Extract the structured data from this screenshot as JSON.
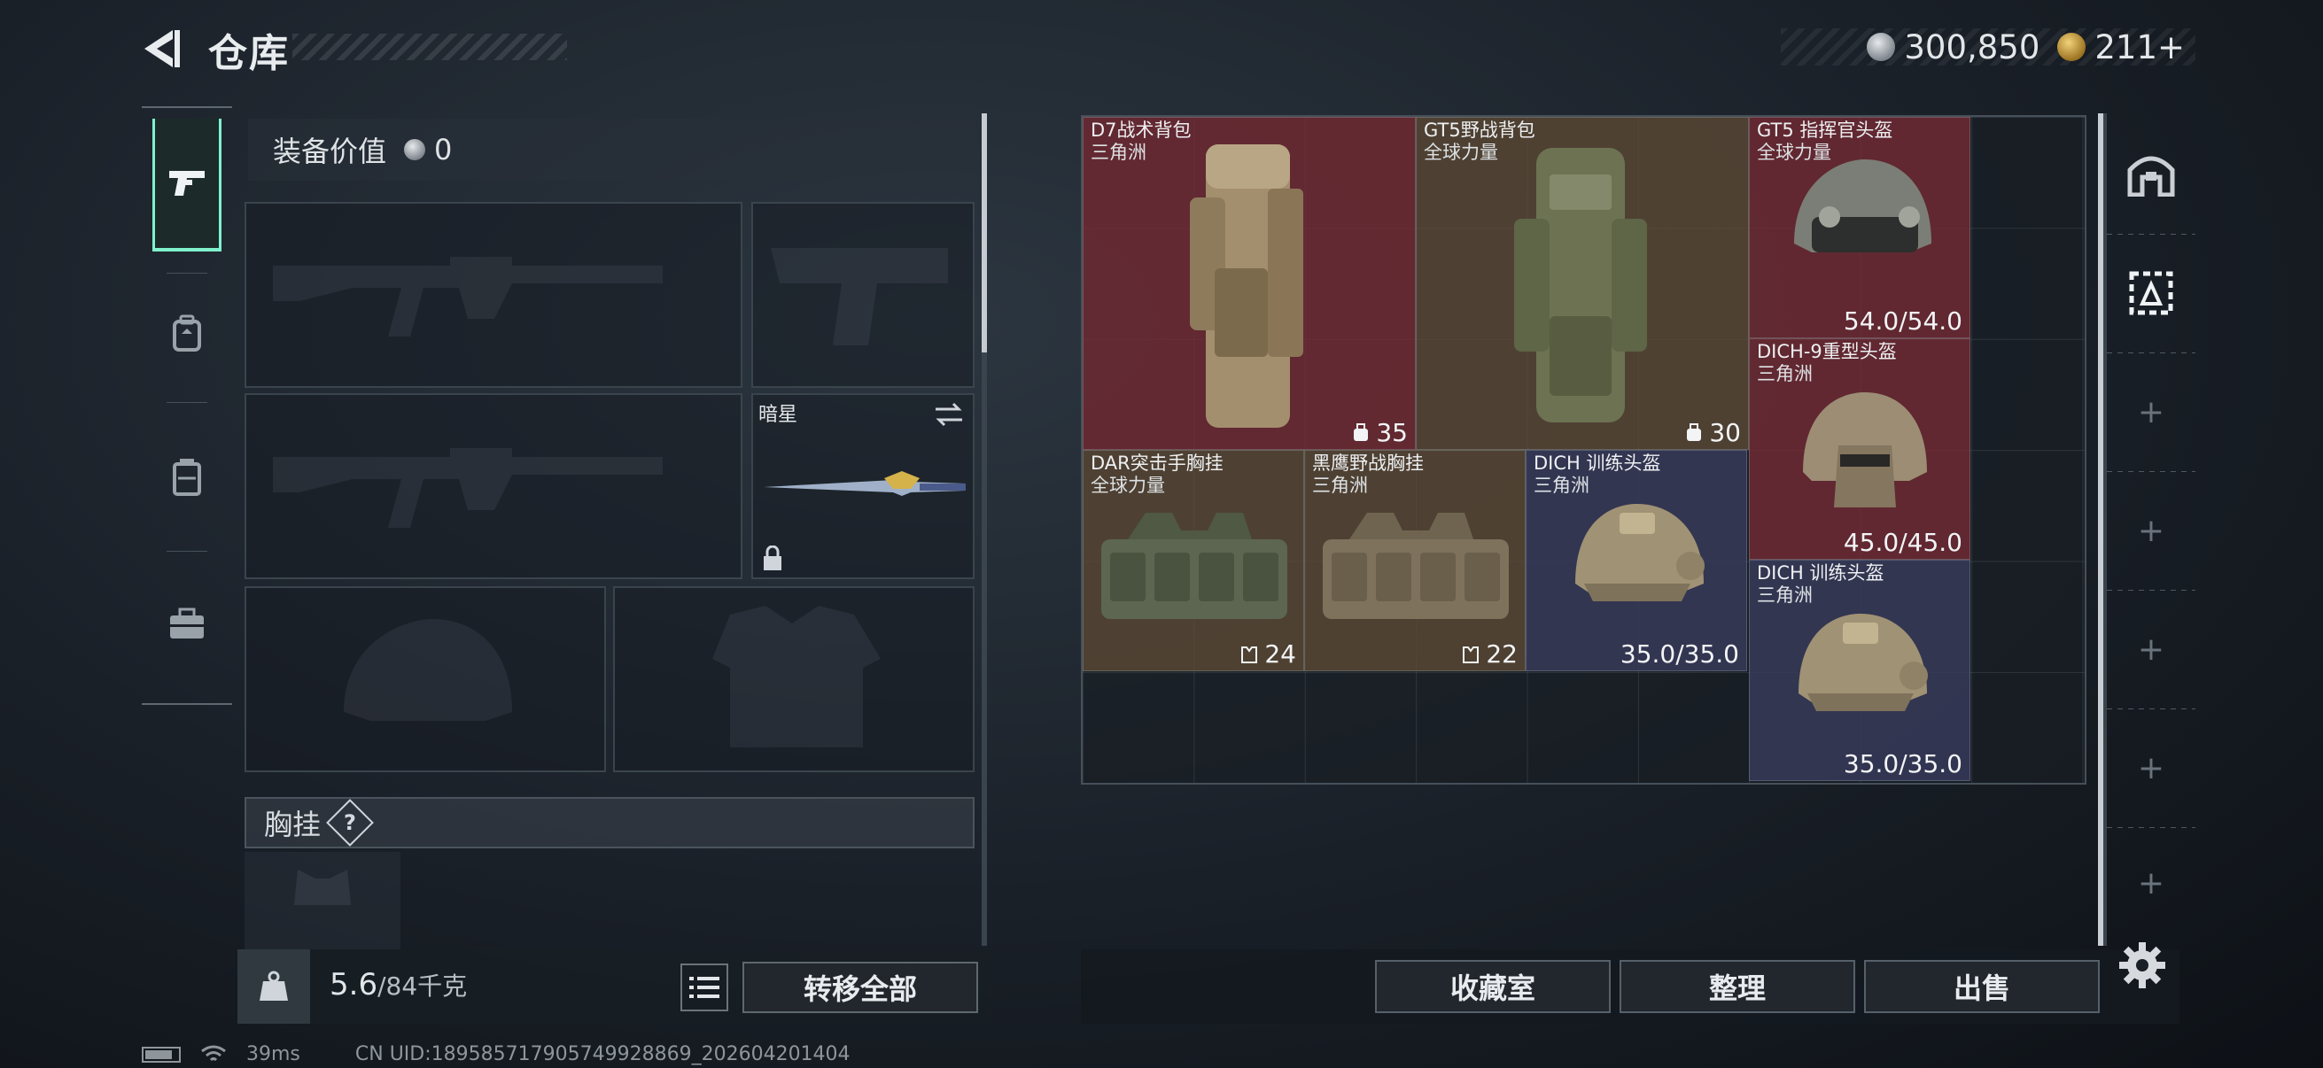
{
  "header": {
    "title": "仓库",
    "currency": [
      {
        "icon": "silver-coin-icon",
        "value": "300,850"
      },
      {
        "icon": "gold-coin-icon",
        "value": "211+"
      }
    ]
  },
  "nav": {
    "items": [
      "pistol-icon",
      "backpack-icon",
      "rig-icon",
      "briefcase-icon"
    ],
    "active": "pistol-icon"
  },
  "loadout": {
    "equip_value_label": "装备价值",
    "equip_value": "0",
    "melee_label": "暗星",
    "chest_label": "胸挂",
    "help_label": "?"
  },
  "capacity": {
    "weight": "5.6",
    "limit": "/84千克",
    "transfer_label": "转移全部"
  },
  "status": {
    "ping": "39ms",
    "uid": "CN UID:1895857179057499288​69_202604201404"
  },
  "stash": {
    "items": [
      {
        "name": "D7战术背包",
        "source": "三角洲",
        "stat": "35",
        "stat_icon": "bag-capacity-icon",
        "rarity_color": "#762c34"
      },
      {
        "name": "GT5野战背包",
        "source": "全球力量",
        "stat": "30",
        "stat_icon": "bag-capacity-icon",
        "rarity_color": "#624e38"
      },
      {
        "name": "GT5 指挥官头盔",
        "source": "全球力量",
        "stat": "54.0/54.0",
        "rarity_color": "#762c34"
      },
      {
        "name": "DICH-9重型头盔",
        "source": "三角洲",
        "stat": "45.0/45.0",
        "rarity_color": "#762c34"
      },
      {
        "name": "DAR突击手胸挂",
        "source": "全球力量",
        "stat": "24",
        "stat_icon": "rig-capacity-icon",
        "rarity_color": "#624e38"
      },
      {
        "name": "黑鹰野战胸挂",
        "source": "三角洲",
        "stat": "22",
        "stat_icon": "rig-capacity-icon",
        "rarity_color": "#624e38"
      },
      {
        "name": "DICH 训练头盔",
        "source": "三角洲",
        "stat": "35.0/35.0",
        "rarity_color": "#3a3c5c"
      },
      {
        "name": "DICH 训练头盔",
        "source": "三角洲",
        "stat": "35.0/35.0",
        "rarity_color": "#3a3c5c"
      }
    ]
  },
  "actions": {
    "collection": "收藏室",
    "sort": "整理",
    "sell": "出售"
  }
}
